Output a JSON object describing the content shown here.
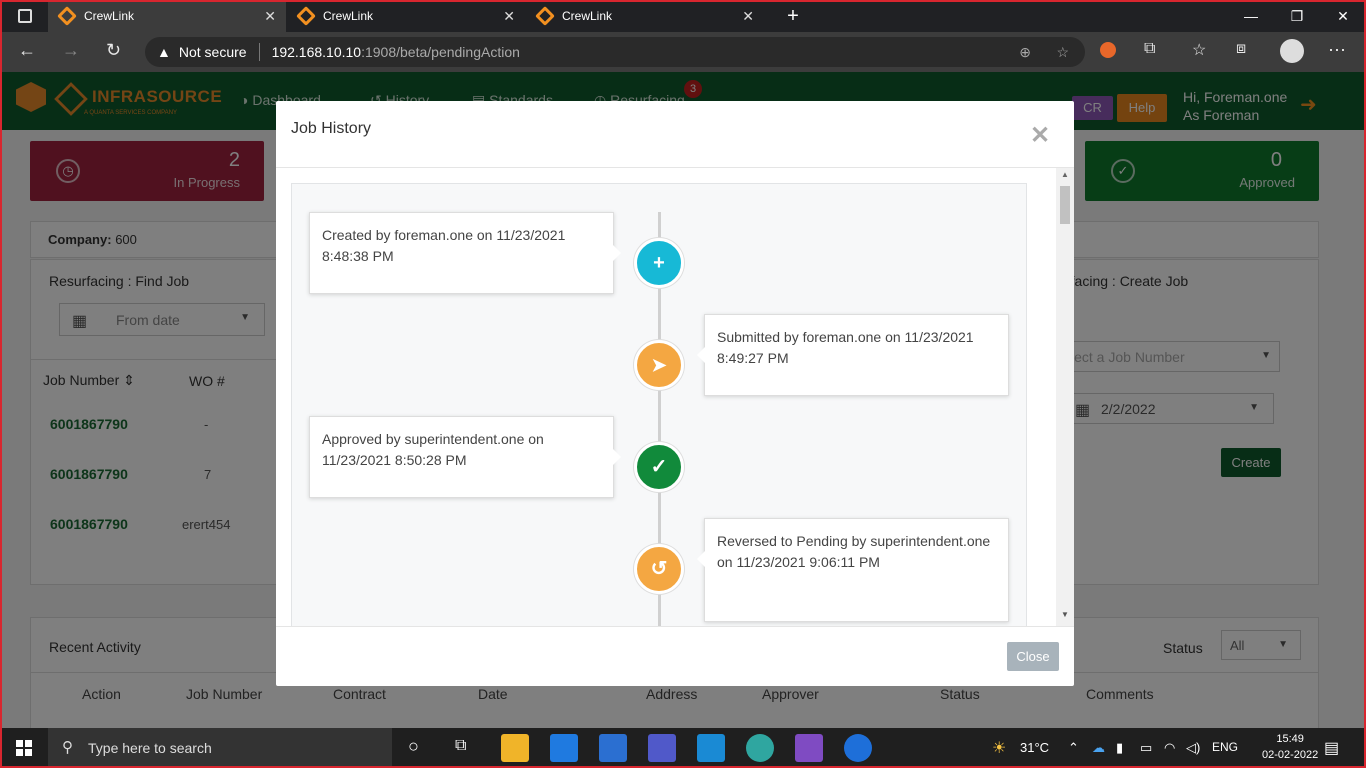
{
  "browser": {
    "tabs": [
      {
        "title": "CrewLink"
      },
      {
        "title": "CrewLink"
      },
      {
        "title": "CrewLink"
      }
    ],
    "security_label": "Not secure",
    "url_host": "192.168.10.10",
    "url_path": ":1908/beta/pendingAction"
  },
  "app": {
    "brand": "INFRASOURCE",
    "brand_sub": "A QUANTA SERVICES COMPANY",
    "nav": [
      "Dashboard",
      "History",
      "Standards",
      "Resurfacing"
    ],
    "resurfacing_badge": "3",
    "cr_label": "CR",
    "help_label": "Help",
    "greeting": "Hi, Foreman.one",
    "role": "As Foreman",
    "in_progress": {
      "count": "2",
      "label": "In Progress"
    },
    "approved": {
      "count": "0",
      "label": "Approved"
    },
    "company_label": "Company:",
    "company_value": "600",
    "find_title": "Resurfacing : Find Job",
    "from_date_placeholder": "From date",
    "job_header": "Job Number",
    "wo_header": "WO #",
    "jobs": [
      {
        "number": "6001867790",
        "wo": "-"
      },
      {
        "number": "6001867790",
        "wo": "7"
      },
      {
        "number": "6001867790",
        "wo": "erert454"
      }
    ],
    "create_title": "rfacing : Create Job",
    "job_number_placeholder": "lect a Job Number",
    "create_date": "2/2/2022",
    "create_label": "Create",
    "recent_title": "Recent Activity",
    "status_label": "Status",
    "status_value": "All",
    "columns": [
      "Action",
      "Job Number",
      "Contract",
      "Date",
      "Address",
      "Approver",
      "Status",
      "Comments"
    ]
  },
  "modal": {
    "title": "Job History",
    "close_label": "Close",
    "entries": [
      {
        "text": "Created by foreman.one on 11/23/2021 8:48:38 PM",
        "icon": "plus-icon",
        "color": "#17b9d6"
      },
      {
        "text": "Submitted by foreman.one on 11/23/2021 8:49:27 PM",
        "icon": "paper-plane-icon",
        "color": "#f4a742"
      },
      {
        "text": "Approved by superintendent.one on 11/23/2021 8:50:28 PM",
        "icon": "check-icon",
        "color": "#118a3b"
      },
      {
        "text": "Reversed to Pending by superintendent.one on 11/23/2021 9:06:11 PM",
        "icon": "undo-icon",
        "color": "#f4a742"
      }
    ]
  },
  "taskbar": {
    "search_placeholder": "Type here to search",
    "temperature": "31°C",
    "language": "ENG",
    "time": "15:49",
    "date": "02-02-2022"
  }
}
